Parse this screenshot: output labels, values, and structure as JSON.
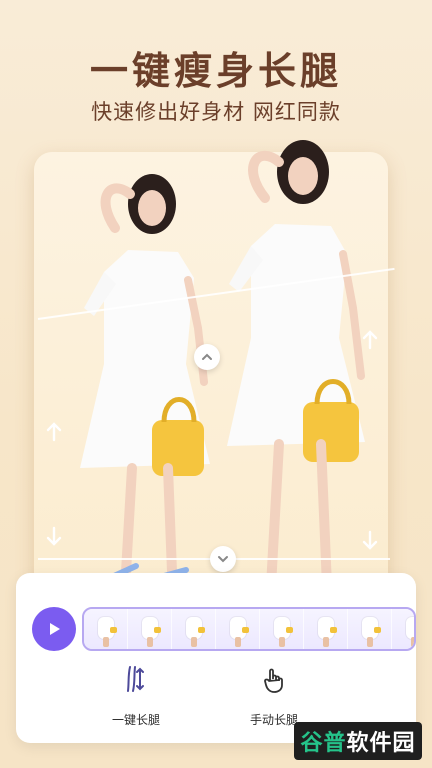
{
  "header": {
    "title": "一键瘦身长腿",
    "subtitle": "快速修出好身材 网红同款"
  },
  "tools": [
    {
      "label": "一键长腿",
      "icon": "legs-icon"
    },
    {
      "label": "手动长腿",
      "icon": "hand-icon"
    }
  ],
  "watermark": {
    "part1": "谷普",
    "part2": "软件园"
  },
  "colors": {
    "accent": "#7b5cf0",
    "title": "#6b3f2a",
    "background": "#f8ead2"
  }
}
